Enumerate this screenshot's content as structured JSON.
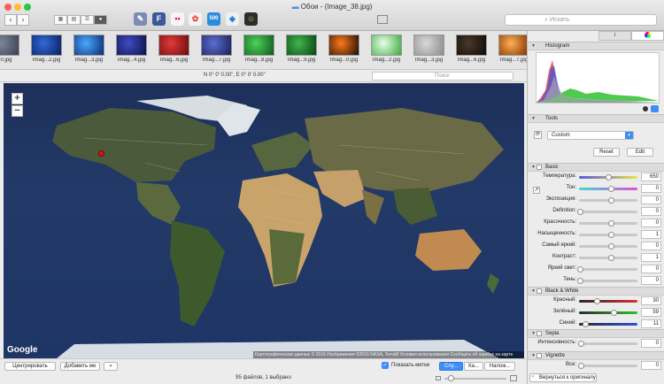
{
  "window": {
    "title": "Обои - (Image_38.jpg)"
  },
  "toolbar": {
    "back": "‹",
    "forward": "›",
    "search_placeholder": "Искать",
    "app_icons": [
      "F",
      "500"
    ]
  },
  "thumbnails": [
    {
      "label": "...0.jpg",
      "c1": "#7d8699",
      "c2": "#3a4053"
    },
    {
      "label": "Imag...2.jpg",
      "c1": "#2f6ad8",
      "c2": "#0b1e60"
    },
    {
      "label": "Imag...3.jpg",
      "c1": "#4aa8ff",
      "c2": "#0a2a70"
    },
    {
      "label": "Imag...4.jpg",
      "c1": "#3e4cc8",
      "c2": "#0e1240"
    },
    {
      "label": "Imag...6.jpg",
      "c1": "#e23a3a",
      "c2": "#6a0a0a"
    },
    {
      "label": "Imag...7.jpg",
      "c1": "#5a6fd0",
      "c2": "#1a1f55"
    },
    {
      "label": "Imag...8.jpg",
      "c1": "#4fd05a",
      "c2": "#0d5a1a"
    },
    {
      "label": "Imag...9.jpg",
      "c1": "#3fb64c",
      "c2": "#094413"
    },
    {
      "label": "Imag...0.jpg",
      "c1": "#ff7a1a",
      "c2": "#1a0a05"
    },
    {
      "label": "Imag...2.jpg",
      "c1": "#e8ffe6",
      "c2": "#3aa83f"
    },
    {
      "label": "Imag...3.jpg",
      "c1": "#d8d8d8",
      "c2": "#8a8a8a"
    },
    {
      "label": "Imag...6.jpg",
      "c1": "#4a3a2a",
      "c2": "#0d0805"
    },
    {
      "label": "Imag...7.jpg",
      "c1": "#ffb050",
      "c2": "#7a2a00"
    }
  ],
  "map": {
    "coords": "N 0° 0' 0.00\", E 0° 0' 0.00\"",
    "search_placeholder": "Поиск",
    "zoom_in": "+",
    "zoom_out": "−",
    "brand": "Google",
    "attribution": "Картографические данные © 2016 Изображения ©2016 NASA, TerraM Условия использования Сообщить об ошибке на карте"
  },
  "bottom": {
    "center_btn": "Центрировать",
    "add_btn": "Добавить ме",
    "show_labels": "Показать метки",
    "seg": [
      "Спу...",
      "Ка...",
      "Налож..."
    ],
    "status": "95 файлов, 1 выбрано"
  },
  "panel": {
    "tab_info": "i",
    "histogram": "Histogram",
    "tools": "Tools",
    "preset": "Custom",
    "reset": "Reset",
    "edit": "Edit",
    "basic": "Basic",
    "bw": "Black & White",
    "sepia": "Sepia",
    "vignette": "Vignette",
    "revert": "Вернуться к оригиналу"
  },
  "sliders": [
    {
      "label": "Температура:",
      "value": "650",
      "pos": 0.5,
      "grad": "linear-gradient(90deg,#5a5adf,#e5e54a)"
    },
    {
      "label": "Тон:",
      "value": "0",
      "pos": 0.55,
      "grad": "linear-gradient(90deg,#3ed7d7,#e04fd0)"
    },
    {
      "label": "Экспозиция:",
      "value": "0",
      "pos": 0.55,
      "grad": ""
    },
    {
      "label": "Definition:",
      "value": "0",
      "pos": 0.02,
      "grad": ""
    },
    {
      "label": "Красочность:",
      "value": "0",
      "pos": 0.55,
      "grad": ""
    },
    {
      "label": "Насыщенность:",
      "value": "1",
      "pos": 0.55,
      "grad": ""
    },
    {
      "label": "Самый яркий:",
      "value": "0",
      "pos": 0.55,
      "grad": ""
    },
    {
      "label": "Контраст:",
      "value": "1",
      "pos": 0.55,
      "grad": ""
    },
    {
      "label": "Яркий свет:",
      "value": "0",
      "pos": 0.02,
      "grad": ""
    },
    {
      "label": "Тень:",
      "value": "0",
      "pos": 0.02,
      "grad": ""
    }
  ],
  "bw_sliders": [
    {
      "label": "Красный:",
      "value": "30",
      "pos": 0.3,
      "grad": "linear-gradient(90deg,#2a2a2a,#e03030)"
    },
    {
      "label": "Зелёный:",
      "value": "59",
      "pos": 0.59,
      "grad": "linear-gradient(90deg,#2a2a2a,#30c030)"
    },
    {
      "label": "Синий:",
      "value": "11",
      "pos": 0.11,
      "grad": "linear-gradient(90deg,#2a2a2a,#3050e0)"
    }
  ],
  "sepia_slider": {
    "label": "Интенсивность:",
    "value": "0"
  },
  "vignette_slider": {
    "label": "Все:",
    "value": "0"
  }
}
